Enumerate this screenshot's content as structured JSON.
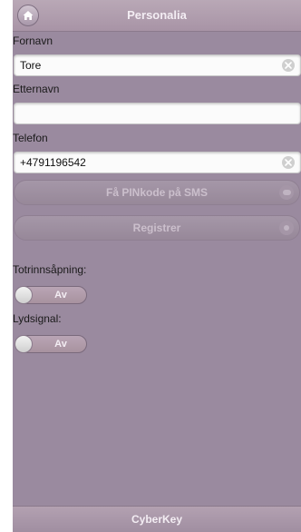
{
  "header": {
    "title": "Personalia",
    "home_icon": "home-icon"
  },
  "form": {
    "fornavn_label": "Fornavn",
    "fornavn_value": "Tore",
    "etternavn_label": "Etternavn",
    "etternavn_value": "",
    "telefon_label": "Telefon",
    "telefon_value": "+4791196542"
  },
  "buttons": {
    "sms_label": "Få PINkode på SMS",
    "register_label": "Registrer"
  },
  "settings": {
    "totrinn_label": "Totrinnsåpning:",
    "totrinn_state": "Av",
    "lydsignal_label": "Lydsignal:",
    "lydsignal_state": "Av"
  },
  "footer": {
    "title": "CyberKey"
  },
  "colors": {
    "panel": "#9a8a9f",
    "header": "#ad9aab",
    "input_bg": "#fbfbfb"
  }
}
